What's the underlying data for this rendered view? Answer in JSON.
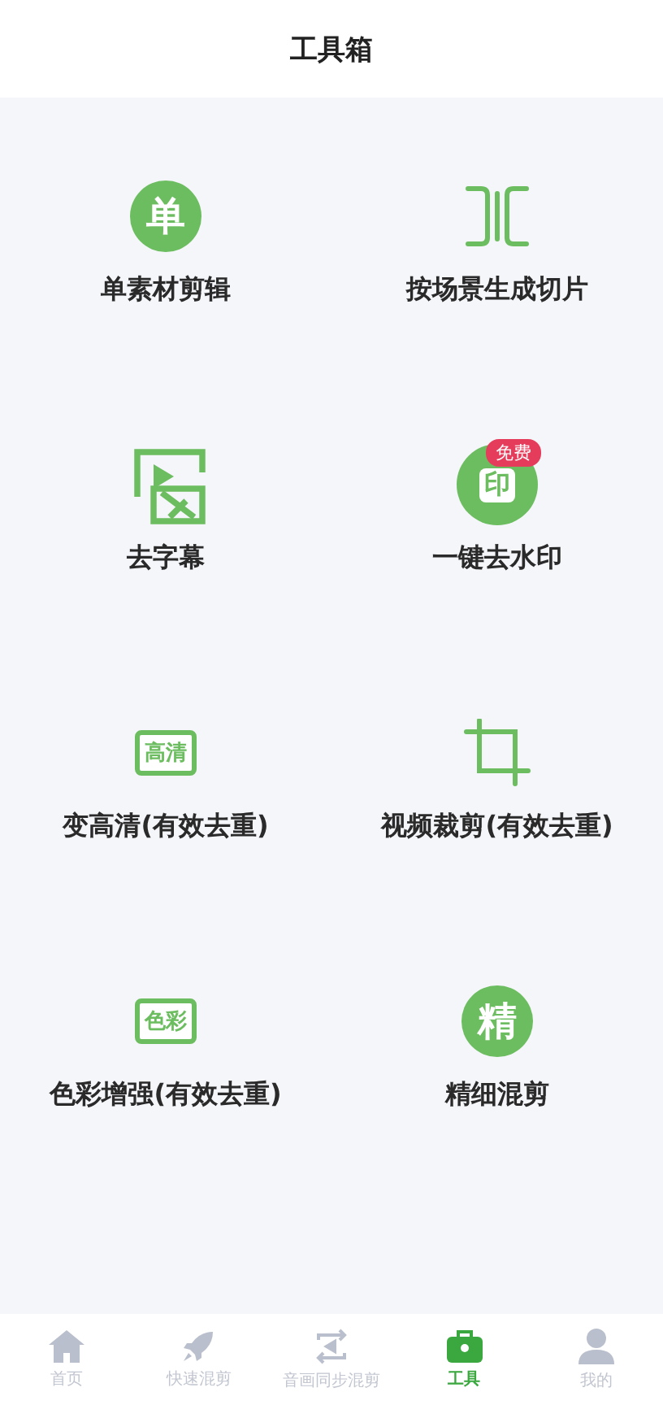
{
  "header": {
    "title": "工具箱"
  },
  "tool_rows": [
    {
      "tools": [
        {
          "label": "单素材剪辑",
          "icon": {
            "kind": "circle",
            "text": "单"
          }
        },
        {
          "label": "按场景生成切片",
          "icon": {
            "kind": "brackets"
          }
        }
      ]
    },
    {
      "tools": [
        {
          "label": "去字幕",
          "icon": {
            "kind": "subtitle"
          }
        },
        {
          "label": "一键去水印",
          "icon": {
            "kind": "stamp",
            "text": "印"
          },
          "badge": "免费"
        }
      ]
    },
    {
      "tools": [
        {
          "label": "变高清(有效去重)",
          "icon": {
            "kind": "boxtext",
            "text": "高清"
          }
        },
        {
          "label": "视频裁剪(有效去重)",
          "icon": {
            "kind": "crop"
          }
        }
      ]
    },
    {
      "tools": [
        {
          "label": "色彩增强(有效去重)",
          "icon": {
            "kind": "boxtext",
            "text": "色彩"
          }
        },
        {
          "label": "精细混剪",
          "icon": {
            "kind": "circle",
            "text": "精"
          }
        }
      ]
    }
  ],
  "tab_bar": [
    {
      "label": "首页",
      "selected": false
    },
    {
      "label": "快速混剪",
      "selected": false
    },
    {
      "label": "音画同步混剪",
      "selected": false
    },
    {
      "label": "工具",
      "selected": true
    },
    {
      "label": "我的",
      "selected": false
    }
  ]
}
